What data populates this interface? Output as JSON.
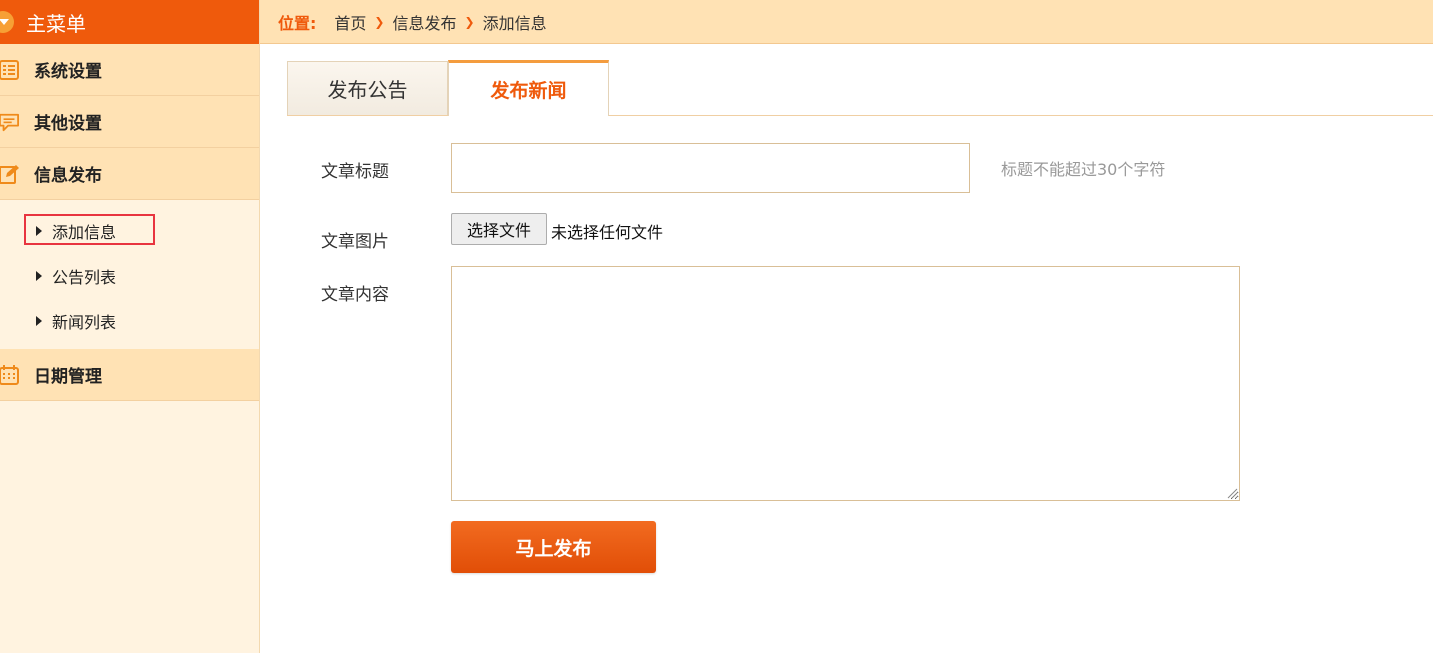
{
  "sidebar": {
    "header": "主菜单",
    "sections": [
      {
        "label": "系统设置",
        "icon": "list-icon"
      },
      {
        "label": "其他设置",
        "icon": "comment-icon"
      },
      {
        "label": "信息发布",
        "icon": "edit-icon"
      },
      {
        "label": "日期管理",
        "icon": "calendar-icon"
      }
    ],
    "sub_items": [
      {
        "label": "添加信息",
        "selected": true
      },
      {
        "label": "公告列表"
      },
      {
        "label": "新闻列表"
      }
    ]
  },
  "breadcrumb": {
    "label": "位置:",
    "items": [
      "首页",
      "信息发布",
      "添加信息"
    ]
  },
  "tabs": [
    {
      "label": "发布公告",
      "active": false
    },
    {
      "label": "发布新闻",
      "active": true
    }
  ],
  "form": {
    "title_label": "文章标题",
    "title_value": "",
    "title_hint": "标题不能超过30个字符",
    "image_label": "文章图片",
    "file_button": "选择文件",
    "file_status": "未选择任何文件",
    "content_label": "文章内容",
    "content_value": "",
    "submit_label": "马上发布"
  },
  "colors": {
    "accent": "#ef5a0c",
    "sidebar_bg": "#fff3e0",
    "section_bg": "#ffe2b4",
    "highlight_box": "#e8343f"
  }
}
